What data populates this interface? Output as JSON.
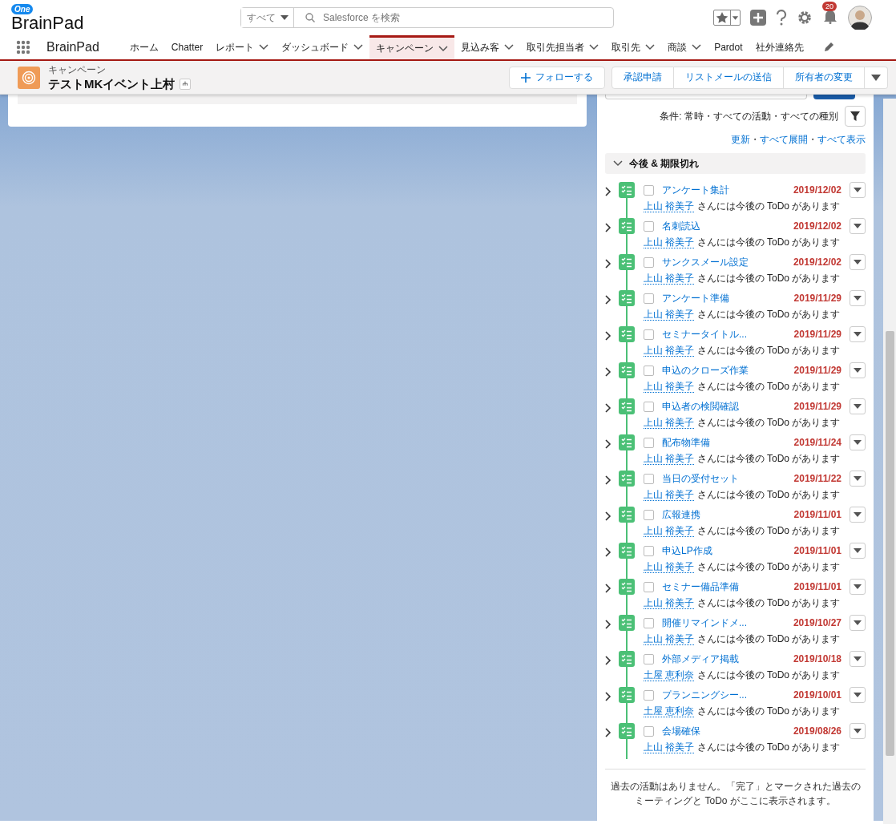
{
  "header": {
    "logo_badge": "One",
    "logo_name": "BrainPad",
    "search_scope": "すべて",
    "search_placeholder": "Salesforce を検索",
    "notification_count": "20"
  },
  "nav": {
    "app_name": "BrainPad",
    "items": [
      {
        "label": "ホーム",
        "has_menu": false,
        "selected": false
      },
      {
        "label": "Chatter",
        "has_menu": false,
        "selected": false
      },
      {
        "label": "レポート",
        "has_menu": true,
        "selected": false
      },
      {
        "label": "ダッシュボード",
        "has_menu": true,
        "selected": false
      },
      {
        "label": "キャンペーン",
        "has_menu": true,
        "selected": true
      },
      {
        "label": "見込み客",
        "has_menu": true,
        "selected": false
      },
      {
        "label": "取引先担当者",
        "has_menu": true,
        "selected": false
      },
      {
        "label": "取引先",
        "has_menu": true,
        "selected": false
      },
      {
        "label": "商談",
        "has_menu": true,
        "selected": false
      },
      {
        "label": "Pardot",
        "has_menu": false,
        "selected": false
      },
      {
        "label": "社外連絡先",
        "has_menu": false,
        "selected": false
      }
    ]
  },
  "record": {
    "object_type": "キャンペーン",
    "title": "テストMKイベント上村",
    "follow": "フォローする",
    "actions": [
      "承認申請",
      "リストメールの送信",
      "所有者の変更"
    ]
  },
  "activity": {
    "filter": "条件: 常時・すべての活動・すべての種別",
    "links": [
      "更新",
      "すべて展開",
      "すべて表示"
    ],
    "link_separator": "・",
    "section": "今後 & 期限切れ",
    "tasks": [
      {
        "title": "アンケート集計",
        "date": "2019/12/02",
        "owner": "上山 裕美子",
        "text": "さんには今後の ToDo があります",
        "checked": false
      },
      {
        "title": "名刺読込",
        "date": "2019/12/02",
        "owner": "上山 裕美子",
        "text": "さんには今後の ToDo があります",
        "checked": false
      },
      {
        "title": "サンクスメール設定",
        "date": "2019/12/02",
        "owner": "上山 裕美子",
        "text": "さんには今後の ToDo があります",
        "checked": false
      },
      {
        "title": "アンケート準備",
        "date": "2019/11/29",
        "owner": "上山 裕美子",
        "text": "さんには今後の ToDo があります",
        "checked": false
      },
      {
        "title": "セミナータイトル...",
        "date": "2019/11/29",
        "owner": "上山 裕美子",
        "text": "さんには今後の ToDo があります",
        "checked": false
      },
      {
        "title": "申込のクローズ作業",
        "date": "2019/11/29",
        "owner": "上山 裕美子",
        "text": "さんには今後の ToDo があります",
        "checked": false
      },
      {
        "title": "申込者の検閲確認",
        "date": "2019/11/29",
        "owner": "上山 裕美子",
        "text": "さんには今後の ToDo があります",
        "checked": false
      },
      {
        "title": "配布物準備",
        "date": "2019/11/24",
        "owner": "上山 裕美子",
        "text": "さんには今後の ToDo があります",
        "checked": false
      },
      {
        "title": "当日の受付セット",
        "date": "2019/11/22",
        "owner": "上山 裕美子",
        "text": "さんには今後の ToDo があります",
        "checked": false
      },
      {
        "title": "広報連携",
        "date": "2019/11/01",
        "owner": "上山 裕美子",
        "text": "さんには今後の ToDo があります",
        "checked": false
      },
      {
        "title": "申込LP作成",
        "date": "2019/11/01",
        "owner": "上山 裕美子",
        "text": "さんには今後の ToDo があります",
        "checked": false
      },
      {
        "title": "セミナー備品準備",
        "date": "2019/11/01",
        "owner": "上山 裕美子",
        "text": "さんには今後の ToDo があります",
        "checked": false
      },
      {
        "title": "開催リマインドメ...",
        "date": "2019/10/27",
        "owner": "上山 裕美子",
        "text": "さんには今後の ToDo があります",
        "checked": false
      },
      {
        "title": "外部メディア掲載",
        "date": "2019/10/18",
        "owner": "土屋 恵利奈",
        "text": "さんには今後の ToDo があります",
        "checked": false
      },
      {
        "title": "プランニングシー...",
        "date": "2019/10/01",
        "owner": "土屋 恵利奈",
        "text": "さんには今後の ToDo があります",
        "checked": false
      },
      {
        "title": "会場確保",
        "date": "2019/08/26",
        "owner": "上山 裕美子",
        "text": "さんには今後の ToDo があります",
        "checked": false
      }
    ],
    "footer": "過去の活動はありません。「完了」とマークされた過去のミーティングと ToDo がここに表示されます。"
  }
}
